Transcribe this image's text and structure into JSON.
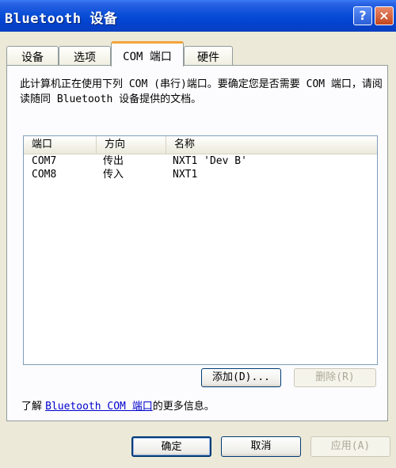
{
  "window": {
    "title": "Bluetooth 设备",
    "help_glyph": "?",
    "close_glyph": "×"
  },
  "tabs": [
    {
      "label": "设备"
    },
    {
      "label": "选项"
    },
    {
      "label": "COM 端口",
      "selected": true
    },
    {
      "label": "硬件"
    }
  ],
  "panel": {
    "description": "此计算机正在使用下列 COM (串行)端口。要确定您是否需要 COM 端口，请阅读随同 Bluetooth 设备提供的文档。",
    "columns": [
      "端口",
      "方向",
      "名称"
    ],
    "rows": [
      {
        "port": "COM7",
        "direction": "传出",
        "name": "NXT1 'Dev B'"
      },
      {
        "port": "COM8",
        "direction": "传入",
        "name": "NXT1"
      }
    ],
    "add_label": "添加(D)...",
    "remove_label": "删除(R)",
    "more_info_prefix": "了解 ",
    "more_info_link": "Bluetooth COM 端口",
    "more_info_suffix": "的更多信息。"
  },
  "footer": {
    "ok_label": "确定",
    "cancel_label": "取消",
    "apply_label": "应用(A)"
  }
}
